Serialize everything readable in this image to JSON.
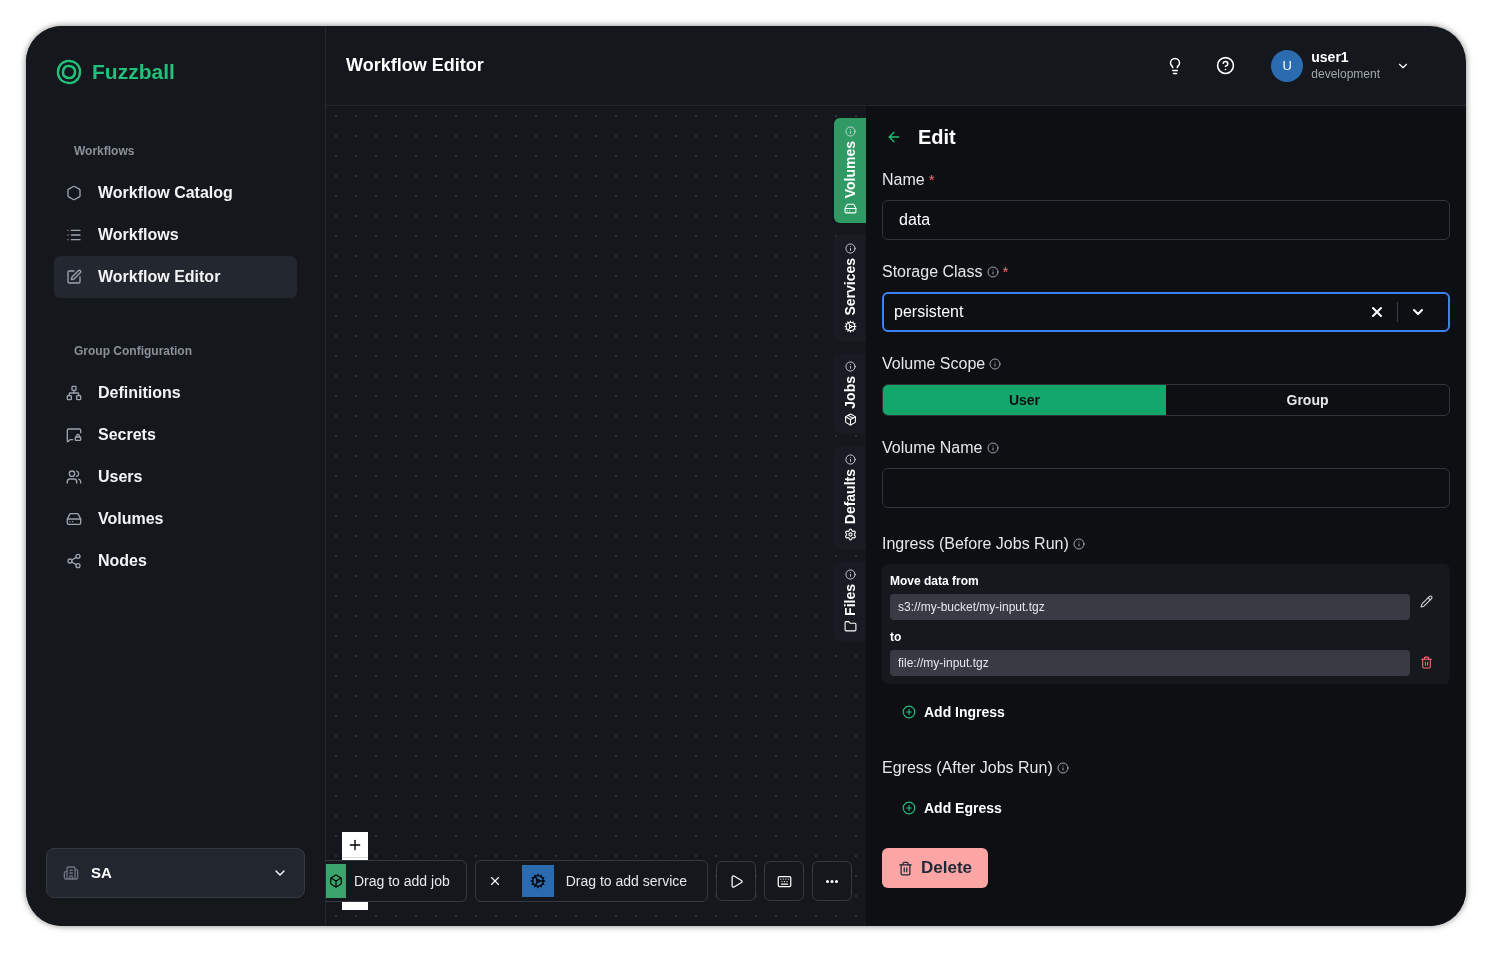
{
  "app": {
    "name": "Fuzzball"
  },
  "sidebar": {
    "sections": [
      {
        "title": "Workflows",
        "items": [
          {
            "label": "Workflow Catalog",
            "selected": false
          },
          {
            "label": "Workflows",
            "selected": false
          },
          {
            "label": "Workflow Editor",
            "selected": true
          }
        ]
      },
      {
        "title": "Group Configuration",
        "items": [
          {
            "label": "Definitions",
            "selected": false
          },
          {
            "label": "Secrets",
            "selected": false
          },
          {
            "label": "Users",
            "selected": false
          },
          {
            "label": "Volumes",
            "selected": false
          },
          {
            "label": "Nodes",
            "selected": false
          }
        ]
      }
    ],
    "org_switcher": {
      "label": "SA"
    }
  },
  "header": {
    "title": "Workflow Editor",
    "user": {
      "initial": "U",
      "name": "user1",
      "environment": "development"
    }
  },
  "canvas": {
    "side_tabs": [
      {
        "label": "Volumes",
        "selected": true
      },
      {
        "label": "Services",
        "selected": false
      },
      {
        "label": "Jobs",
        "selected": false
      },
      {
        "label": "Defaults",
        "selected": false
      },
      {
        "label": "Files",
        "selected": false
      }
    ],
    "toolbar": {
      "job": "Drag to add job",
      "service": "Drag to add service"
    }
  },
  "editor": {
    "title": "Edit",
    "name": {
      "label": "Name",
      "required_mark": "*",
      "value": "data"
    },
    "storage_class": {
      "label": "Storage Class",
      "required_mark": "*",
      "info": true,
      "value": "persistent"
    },
    "volume_scope": {
      "label": "Volume Scope",
      "info": true,
      "options": [
        {
          "label": "User",
          "selected": true
        },
        {
          "label": "Group",
          "selected": false
        }
      ]
    },
    "volume_name": {
      "label": "Volume Name",
      "info": true
    },
    "ingress": {
      "title": "Ingress (Before Jobs Run)",
      "info": true,
      "items": [
        {
          "from_label": "Move data from",
          "from": "s3://my-bucket/my-input.tgz",
          "to_label": "to",
          "to": "file://my-input.tgz"
        }
      ],
      "add": "Add Ingress"
    },
    "egress": {
      "title": "Egress (After Jobs Run)",
      "info": true,
      "add": "Add Egress"
    },
    "delete": "Delete"
  }
}
